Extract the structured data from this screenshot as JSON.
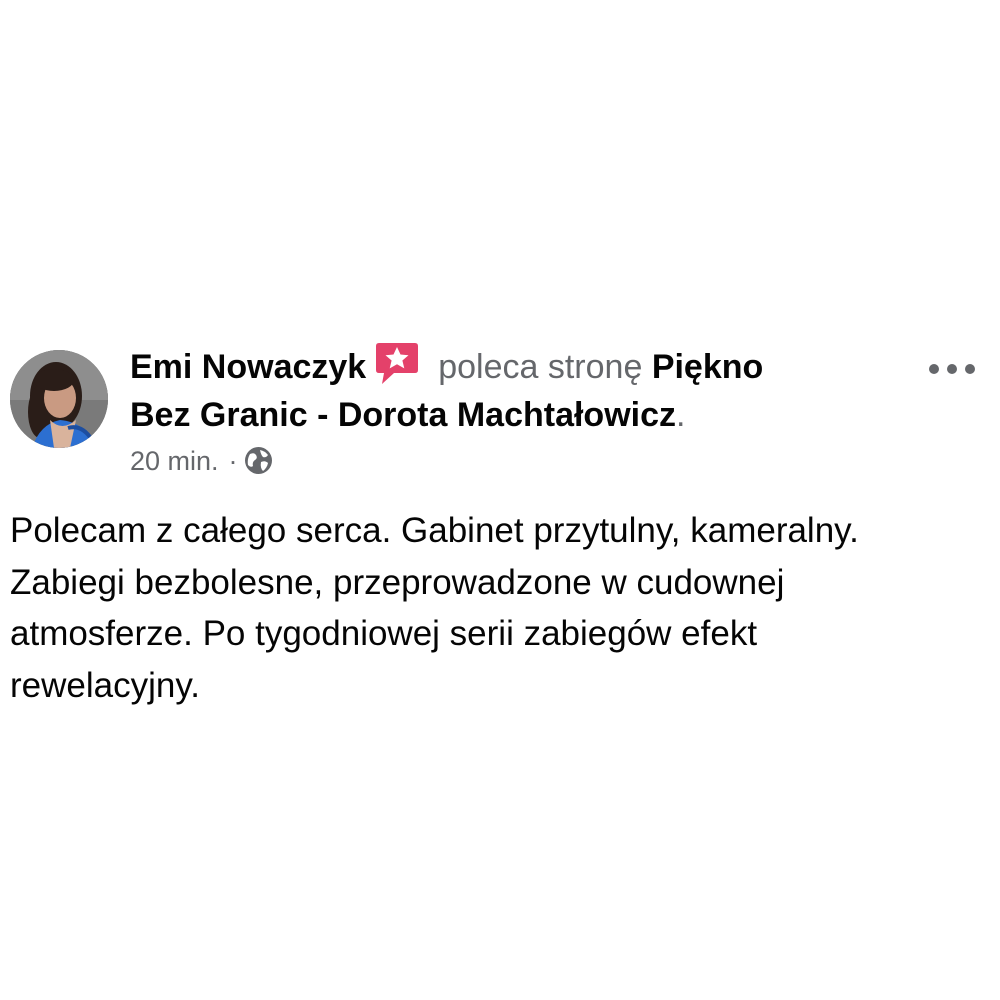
{
  "post": {
    "author_name": "Emi Nowaczyk",
    "action_text": "poleca stronę",
    "page_name_line1": "Piękno",
    "page_name_line2": "Bez Granic - Dorota Machtałowicz",
    "trailing_period": ".",
    "timestamp": "20 min.",
    "meta_separator": "·",
    "audience_icon": "globe-icon",
    "recommend_icon": "recommendation-star-icon",
    "more_icon": "more-options-icon",
    "body_lines": [
      "Polecam z całego serca. Gabinet przytulny, kameralny.",
      "Zabiegi bezbolesne, przeprowadzone w cudownej",
      "atmosferze. Po tygodniowej serii zabiegów efekt",
      "rewelacyjny."
    ]
  },
  "colors": {
    "primary_text": "#050505",
    "secondary_text": "#65676b",
    "recommend_accent": "#e4416a",
    "background": "#ffffff"
  }
}
